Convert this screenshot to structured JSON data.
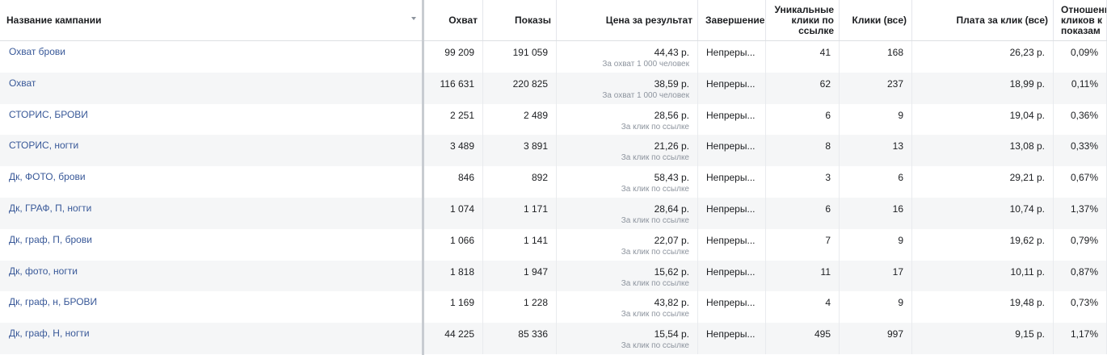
{
  "headers": {
    "name": "Название кампании",
    "reach": "Охват",
    "impressions": "Показы",
    "cost_per_result": "Цена за результат",
    "ends": "Завершение",
    "unique_link_clicks": "Уникальные клики по ссылке",
    "clicks_all": "Клики (все)",
    "cpc": "Плата за клик (все)",
    "ctr": "Отношение кликов к показам"
  },
  "rows": [
    {
      "name": "Охват брови",
      "reach": "99 209",
      "impressions": "191 059",
      "cost": "44,43 р.",
      "cost_sub": "За охват 1 000 человек",
      "ends": "Непреры...",
      "unique": "41",
      "clicks": "168",
      "cpc": "26,23 р.",
      "ctr": "0,09%"
    },
    {
      "name": "Охват",
      "reach": "116 631",
      "impressions": "220 825",
      "cost": "38,59 р.",
      "cost_sub": "За охват 1 000 человек",
      "ends": "Непреры...",
      "unique": "62",
      "clicks": "237",
      "cpc": "18,99 р.",
      "ctr": "0,11%"
    },
    {
      "name": "СТОРИС, БРОВИ",
      "reach": "2 251",
      "impressions": "2 489",
      "cost": "28,56 р.",
      "cost_sub": "За клик по ссылке",
      "ends": "Непреры...",
      "unique": "6",
      "clicks": "9",
      "cpc": "19,04 р.",
      "ctr": "0,36%"
    },
    {
      "name": "СТОРИС, ногти",
      "reach": "3 489",
      "impressions": "3 891",
      "cost": "21,26 р.",
      "cost_sub": "За клик по ссылке",
      "ends": "Непреры...",
      "unique": "8",
      "clicks": "13",
      "cpc": "13,08 р.",
      "ctr": "0,33%"
    },
    {
      "name": "Дк, ФОТО, брови",
      "reach": "846",
      "impressions": "892",
      "cost": "58,43 р.",
      "cost_sub": "За клик по ссылке",
      "ends": "Непреры...",
      "unique": "3",
      "clicks": "6",
      "cpc": "29,21 р.",
      "ctr": "0,67%"
    },
    {
      "name": "Дк, ГРАФ, П, ногти",
      "reach": "1 074",
      "impressions": "1 171",
      "cost": "28,64 р.",
      "cost_sub": "За клик по ссылке",
      "ends": "Непреры...",
      "unique": "6",
      "clicks": "16",
      "cpc": "10,74 р.",
      "ctr": "1,37%"
    },
    {
      "name": "Дк, граф, П, брови",
      "reach": "1 066",
      "impressions": "1 141",
      "cost": "22,07 р.",
      "cost_sub": "За клик по ссылке",
      "ends": "Непреры...",
      "unique": "7",
      "clicks": "9",
      "cpc": "19,62 р.",
      "ctr": "0,79%"
    },
    {
      "name": "Дк, фото, ногти",
      "reach": "1 818",
      "impressions": "1 947",
      "cost": "15,62 р.",
      "cost_sub": "За клик по ссылке",
      "ends": "Непреры...",
      "unique": "11",
      "clicks": "17",
      "cpc": "10,11 р.",
      "ctr": "0,87%"
    },
    {
      "name": "Дк, граф, н, БРОВИ",
      "reach": "1 169",
      "impressions": "1 228",
      "cost": "43,82 р.",
      "cost_sub": "За клик по ссылке",
      "ends": "Непреры...",
      "unique": "4",
      "clicks": "9",
      "cpc": "19,48 р.",
      "ctr": "0,73%"
    },
    {
      "name": "Дк, граф, Н, ногти",
      "reach": "44 225",
      "impressions": "85 336",
      "cost": "15,54 р.",
      "cost_sub": "За клик по ссылке",
      "ends": "Непреры...",
      "unique": "495",
      "clicks": "997",
      "cpc": "9,15 р.",
      "ctr": "1,17%"
    }
  ]
}
